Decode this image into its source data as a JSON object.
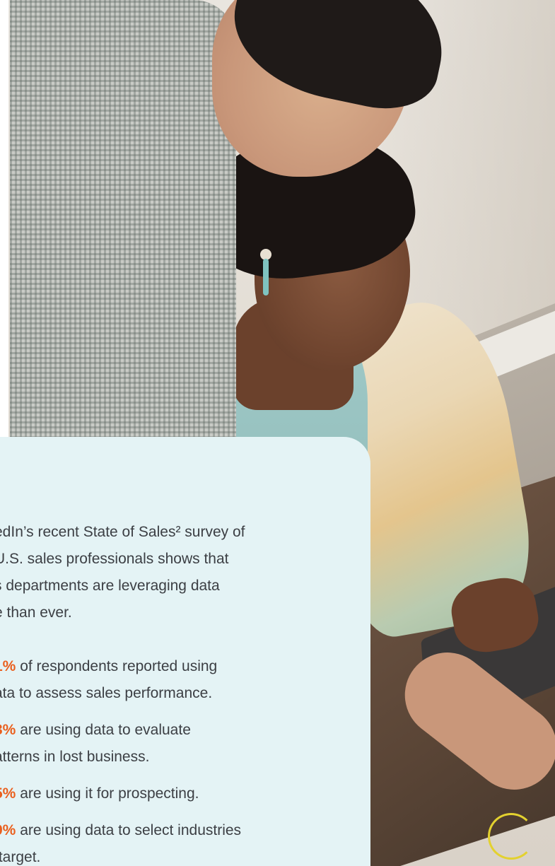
{
  "intro_lines": [
    "edIn’s recent State of Sales² survey of",
    "U.S. sales professionals shows that",
    "s departments are leveraging data",
    "e than ever."
  ],
  "stats": [
    {
      "pct": "1%",
      "lines": [
        " of respondents reported using",
        "ata to assess sales performance."
      ]
    },
    {
      "pct": "3%",
      "lines": [
        " are using data to evaluate",
        "atterns in lost business."
      ]
    },
    {
      "pct": "5%",
      "lines": [
        " are using it for prospecting."
      ]
    },
    {
      "pct": "9%",
      "lines": [
        " are using data to select industries",
        " target."
      ]
    }
  ],
  "colors": {
    "card_background": "#e4f3f5",
    "body_text": "#3c3f44",
    "highlight": "#ea5f1d"
  }
}
